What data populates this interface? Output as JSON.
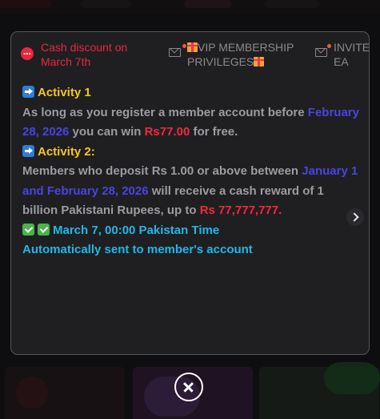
{
  "tabs": [
    {
      "label": "Cash discount on March 7th",
      "icon": "chat-bubble-icon",
      "active": true
    },
    {
      "label": "VIP MEMBERSHIP PRIVILEGES",
      "icon": "envelope-icon",
      "active": false
    },
    {
      "label": "INVITE EA",
      "icon": "envelope-icon",
      "active": false
    }
  ],
  "activity1": {
    "title": "Activity 1",
    "text_a": "As long as you register a member account before ",
    "date": "February 28, 2026",
    "text_b": " you can win ",
    "amount": "Rs77.00",
    "text_c": " for free."
  },
  "activity2": {
    "title": "Activity 2:",
    "text_a": "Members who deposit Rs 1.00 or above between ",
    "dates": "January 1 and February 28, 2026",
    "text_b": " will receive a cash reward of 1 billion Pakistani Rupees, up to ",
    "amount": "Rs 77,777,777."
  },
  "schedule": {
    "time": "March 7, 00:00 Pakistan Time",
    "note": "Automatically sent to member's account"
  },
  "colors": {
    "active_tab": "#e8283c",
    "highlight_blue": "#4a43e0",
    "highlight_red": "#f1293c",
    "heading_yellow": "#f3c624",
    "time_cyan": "#1fb8e6"
  }
}
